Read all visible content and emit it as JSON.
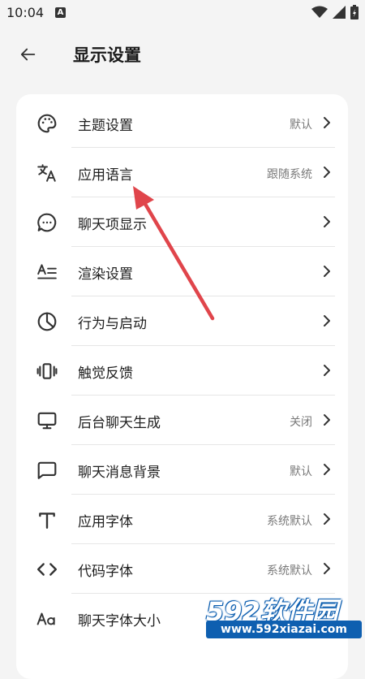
{
  "status": {
    "time": "10:04",
    "notif_badge": "A"
  },
  "header": {
    "title": "显示设置"
  },
  "settings": [
    {
      "label": "主题设置",
      "value": "默认",
      "icon": "palette-icon"
    },
    {
      "label": "应用语言",
      "value": "跟随系统",
      "icon": "translate-icon"
    },
    {
      "label": "聊天项显示",
      "value": "",
      "icon": "chat-bubble-dots-icon"
    },
    {
      "label": "渲染设置",
      "value": "",
      "icon": "text-format-icon"
    },
    {
      "label": "行为与启动",
      "value": "",
      "icon": "pie-clock-icon"
    },
    {
      "label": "触觉反馈",
      "value": "",
      "icon": "vibration-icon"
    },
    {
      "label": "后台聊天生成",
      "value": "关闭",
      "icon": "monitor-icon"
    },
    {
      "label": "聊天消息背景",
      "value": "默认",
      "icon": "message-square-icon"
    },
    {
      "label": "应用字体",
      "value": "系统默认",
      "icon": "font-t-icon"
    },
    {
      "label": "代码字体",
      "value": "系统默认",
      "icon": "code-brackets-icon"
    },
    {
      "label": "聊天字体大小",
      "value": "",
      "icon": "font-size-aa-icon"
    }
  ],
  "watermark": {
    "brand": "592软件园",
    "url": "www.592xiazai.com"
  },
  "colors": {
    "annotation_arrow": "#e0454b",
    "watermark_blue": "#0e5fb0"
  }
}
